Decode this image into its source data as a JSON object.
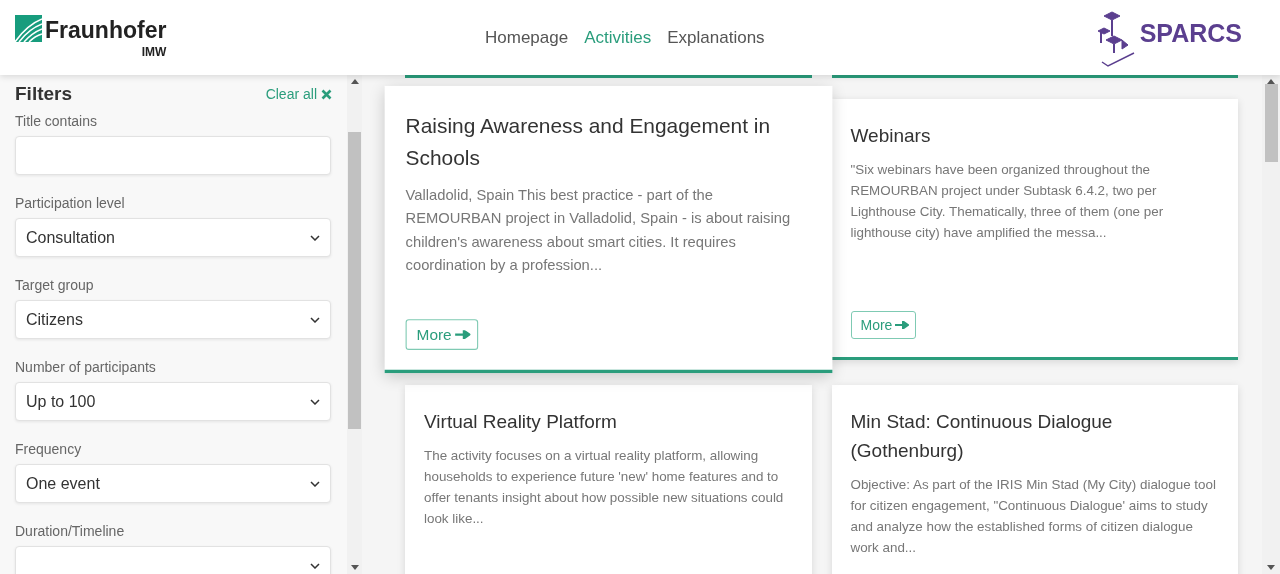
{
  "header": {
    "logo": {
      "name": "Fraunhofer",
      "sub": "IMW"
    },
    "nav": [
      {
        "label": "Homepage",
        "selected": false
      },
      {
        "label": "Activities",
        "selected": true
      },
      {
        "label": "Explanations",
        "selected": false
      }
    ],
    "partner_logo": "SPARCS"
  },
  "sidebar": {
    "title": "Filters",
    "clear": "Clear all",
    "fields": [
      {
        "kind": "text",
        "label": "Title contains"
      },
      {
        "kind": "select",
        "label": "Participation level",
        "value": "Consultation"
      },
      {
        "kind": "select",
        "label": "Target group",
        "value": "Citizens"
      },
      {
        "kind": "select",
        "label": "Number of participants",
        "value": "Up to 100"
      },
      {
        "kind": "select",
        "label": "Frequency",
        "value": "One event"
      },
      {
        "kind": "select",
        "label": "Duration/Timeline"
      }
    ]
  },
  "cards": [
    {
      "title": "Raising Awareness and Engagement in Schools",
      "description": "Valladolid, Spain This best practice - part of the REMOURBAN project in Valladolid, Spain - is about raising children's awareness about smart cities. It requires coordination by a profession...",
      "button": "More",
      "raised": true
    },
    {
      "title": "Webinars",
      "description": "\"Six webinars have been organized throughout the REMOURBAN project under Subtask 6.4.2, two per Lighthouse City. Thematically, three of them (one per lighthouse city) have amplified the messa...",
      "button": "More",
      "raised": false
    },
    {
      "title": "Virtual Reality Platform",
      "description": "The activity focuses on a virtual reality platform, allowing households to experience future 'new' home features and to offer tenants insight about how possible new situations could look like...",
      "raised": false
    },
    {
      "title": "Min Stad: Continuous Dialogue (Gothenburg)",
      "description": "Objective: As part of the IRIS Min Stad (My City) dialogue tool for citizen engagement, \"Continuous Dialogue' aims to study and analyze how the established forms of citizen dialogue work and...",
      "raised": false
    }
  ]
}
